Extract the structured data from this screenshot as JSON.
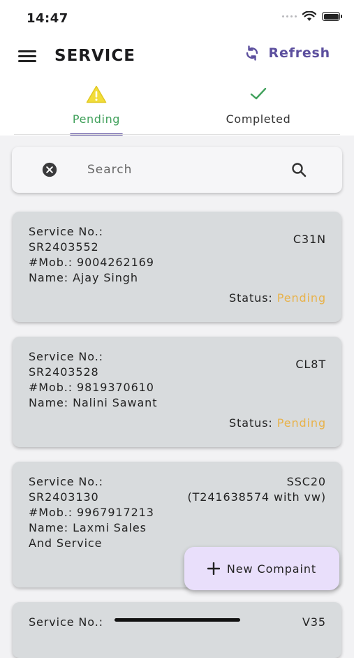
{
  "status_bar": {
    "time": "14:47"
  },
  "app_bar": {
    "title": "SERVICE",
    "refresh_label": "Refresh"
  },
  "tabs": [
    {
      "label": "Pending",
      "icon": "warning-icon",
      "selected": true
    },
    {
      "label": "Completed",
      "icon": "check-icon",
      "selected": false
    }
  ],
  "search": {
    "placeholder": "Search",
    "value": ""
  },
  "services": [
    {
      "label": "Service No.:",
      "number": "SR2403552",
      "mobile": "#Mob.: 9004262169",
      "name_line1": "Name: Ajay Singh",
      "name_line2": "",
      "code_line1": "C31N",
      "code_line2": "",
      "status_label": "Status:",
      "status_value": "Pending"
    },
    {
      "label": "Service No.:",
      "number": "SR2403528",
      "mobile": "#Mob.: 9819370610",
      "name_line1": "Name: Nalini Sawant",
      "name_line2": "",
      "code_line1": "CL8T",
      "code_line2": "",
      "status_label": "Status:",
      "status_value": "Pending"
    },
    {
      "label": "Service No.:",
      "number": "SR2403130",
      "mobile": "#Mob.: 9967917213",
      "name_line1": "Name: Laxmi Sales",
      "name_line2": "And Service",
      "code_line1": "SSC20",
      "code_line2": "(T241638574 with vw)",
      "status_label": "",
      "status_value": ""
    },
    {
      "label": "Service No.:",
      "code_line1": "V35"
    }
  ],
  "fab": {
    "label": "New Compaint"
  },
  "colors": {
    "accent": "#5c4f9e",
    "pending_tab": "#3fa05a",
    "status_pending": "#e8b24a",
    "fab_bg": "#e9dffb",
    "card_bg": "#d8dbdd"
  }
}
